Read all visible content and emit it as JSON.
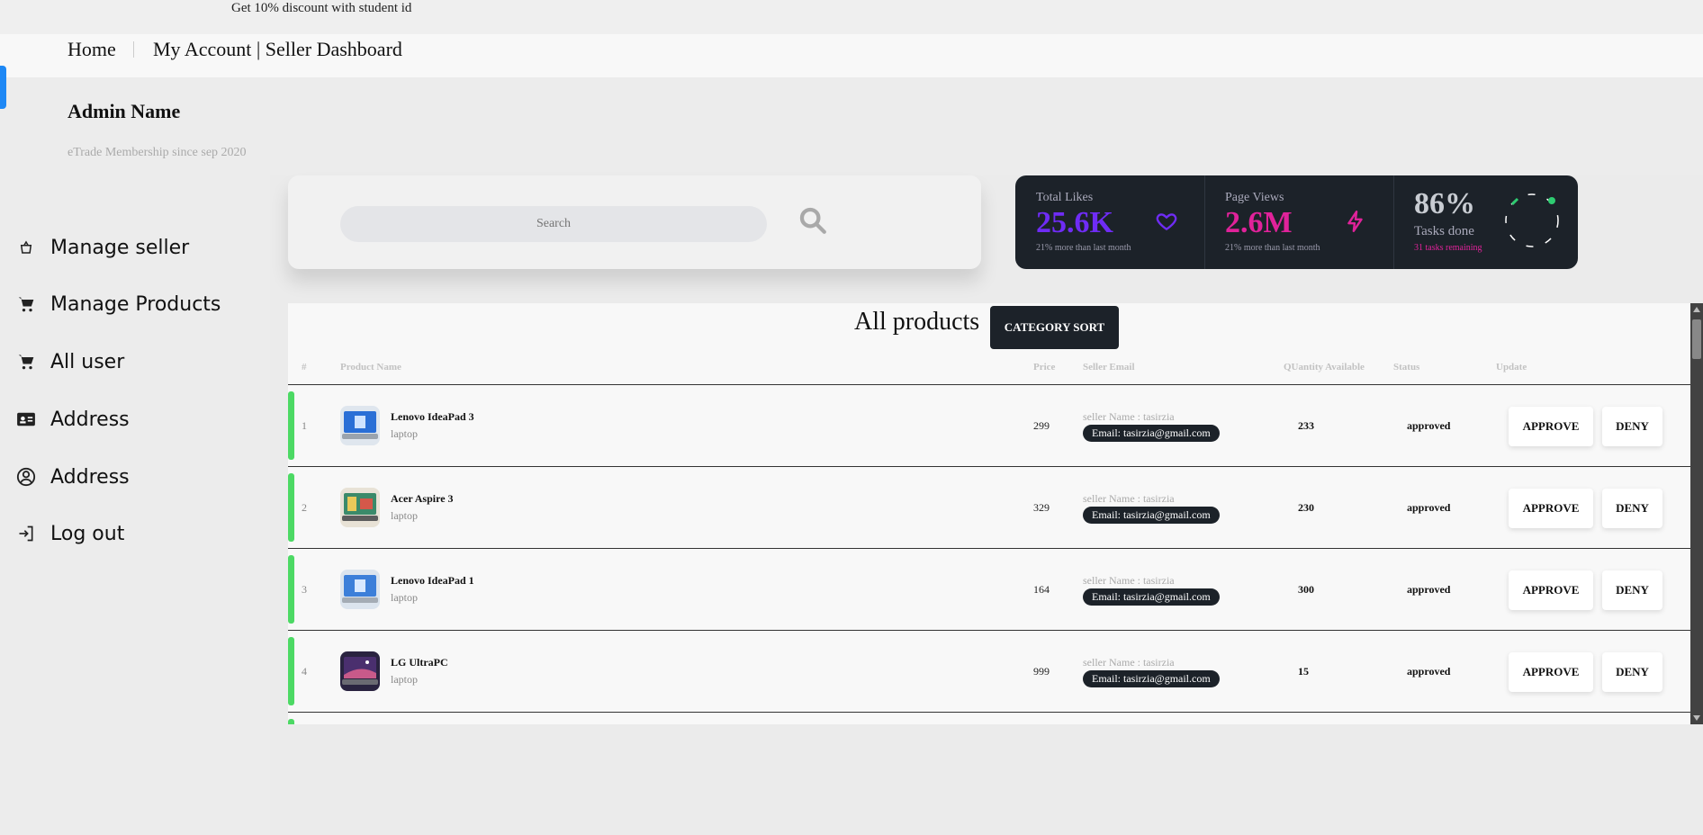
{
  "promo": "Get 10% discount with student id",
  "nav": {
    "home": "Home",
    "account": "My Account | Seller Dashboard"
  },
  "profile": {
    "name": "Admin Name",
    "membership": "eTrade Membership since sep 2020"
  },
  "sidebar": {
    "items": [
      {
        "label": "Manage seller",
        "icon": "basket-icon"
      },
      {
        "label": "Manage Products",
        "icon": "cart-icon"
      },
      {
        "label": "All user",
        "icon": "cart-icon"
      },
      {
        "label": "Address",
        "icon": "id-card-icon"
      },
      {
        "label": "Address",
        "icon": "user-circle-icon"
      },
      {
        "label": "Log out",
        "icon": "logout-icon"
      }
    ]
  },
  "search": {
    "placeholder": "Search"
  },
  "stats": [
    {
      "title": "Total Likes",
      "value": "25.6K",
      "sub": "21% more than last month",
      "color": "#6f2cf5",
      "icon": "heart-icon"
    },
    {
      "title": "Page Views",
      "value": "2.6M",
      "sub": "21% more than last month",
      "color": "#e0229a",
      "icon": "lightning-icon"
    },
    {
      "title": "Tasks done",
      "value": "86%",
      "sub": "31 tasks remaining",
      "color": "#e0229a",
      "icon": "progress-ring"
    }
  ],
  "products": {
    "title": "All products",
    "sort_button": "CATEGORY SORT",
    "headers": [
      "#",
      "Product Name",
      "Price",
      "Seller Email",
      "QUantity Available",
      "Status",
      "Update"
    ],
    "rows": [
      {
        "index": "1",
        "name": "Lenovo IdeaPad 3",
        "category": "laptop",
        "price": "299",
        "seller": "seller Name : tasirzia",
        "email": "Email: tasirzia@gmail.com",
        "qty": "233",
        "status": "approved",
        "approve": "APPROVE",
        "deny": "DENY"
      },
      {
        "index": "2",
        "name": "Acer Aspire 3",
        "category": "laptop",
        "price": "329",
        "seller": "seller Name : tasirzia",
        "email": "Email: tasirzia@gmail.com",
        "qty": "230",
        "status": "approved",
        "approve": "APPROVE",
        "deny": "DENY"
      },
      {
        "index": "3",
        "name": "Lenovo IdeaPad 1",
        "category": "laptop",
        "price": "164",
        "seller": "seller Name : tasirzia",
        "email": "Email: tasirzia@gmail.com",
        "qty": "300",
        "status": "approved",
        "approve": "APPROVE",
        "deny": "DENY"
      },
      {
        "index": "4",
        "name": "LG UltraPC",
        "category": "laptop",
        "price": "999",
        "seller": "seller Name : tasirzia",
        "email": "Email: tasirzia@gmail.com",
        "qty": "15",
        "status": "approved",
        "approve": "APPROVE",
        "deny": "DENY"
      }
    ]
  }
}
